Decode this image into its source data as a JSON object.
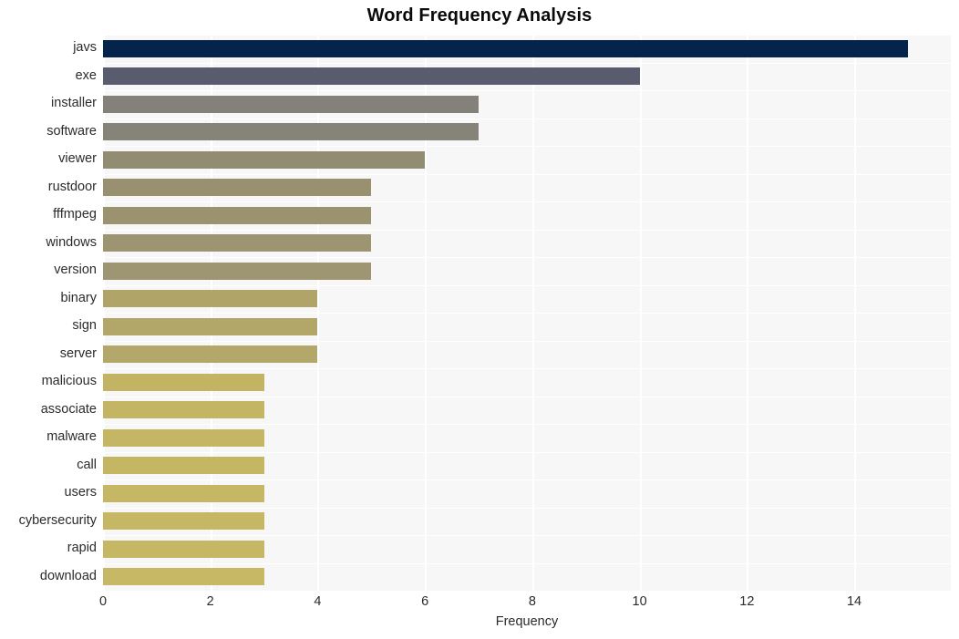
{
  "chart_data": {
    "type": "bar",
    "orientation": "horizontal",
    "title": "Word Frequency Analysis",
    "xlabel": "Frequency",
    "ylabel": "",
    "categories": [
      "javs",
      "exe",
      "installer",
      "software",
      "viewer",
      "rustdoor",
      "fffmpeg",
      "windows",
      "version",
      "binary",
      "sign",
      "server",
      "malicious",
      "associate",
      "malware",
      "call",
      "users",
      "cybersecurity",
      "rapid",
      "download"
    ],
    "values": [
      15,
      10,
      7,
      7,
      6,
      5,
      5,
      5,
      5,
      4,
      4,
      4,
      3,
      3,
      3,
      3,
      3,
      3,
      3,
      3
    ],
    "bar_colors": [
      "#04244c",
      "#585c6e",
      "#83817a",
      "#868379",
      "#928c72",
      "#99906f",
      "#9b9270",
      "#9d9471",
      "#9e9572",
      "#b0a469",
      "#b2a669",
      "#b3a76a",
      "#c3b463",
      "#c4b564",
      "#c5b664",
      "#c5b664",
      "#c6b764",
      "#c6b764",
      "#c6b765",
      "#c7b865"
    ],
    "xlim": [
      0,
      15.8
    ],
    "xticks": [
      0,
      2,
      4,
      6,
      8,
      10,
      12,
      14
    ],
    "xtick_labels": [
      "0",
      "2",
      "4",
      "6",
      "8",
      "10",
      "12",
      "14"
    ],
    "grid": true,
    "grid_color": "#ffffff",
    "plot_background": "#f7f7f7",
    "figure_background": "#ffffff",
    "legend": null,
    "title_color": "#0a0a0a",
    "tick_color": "#2b2b2b"
  }
}
